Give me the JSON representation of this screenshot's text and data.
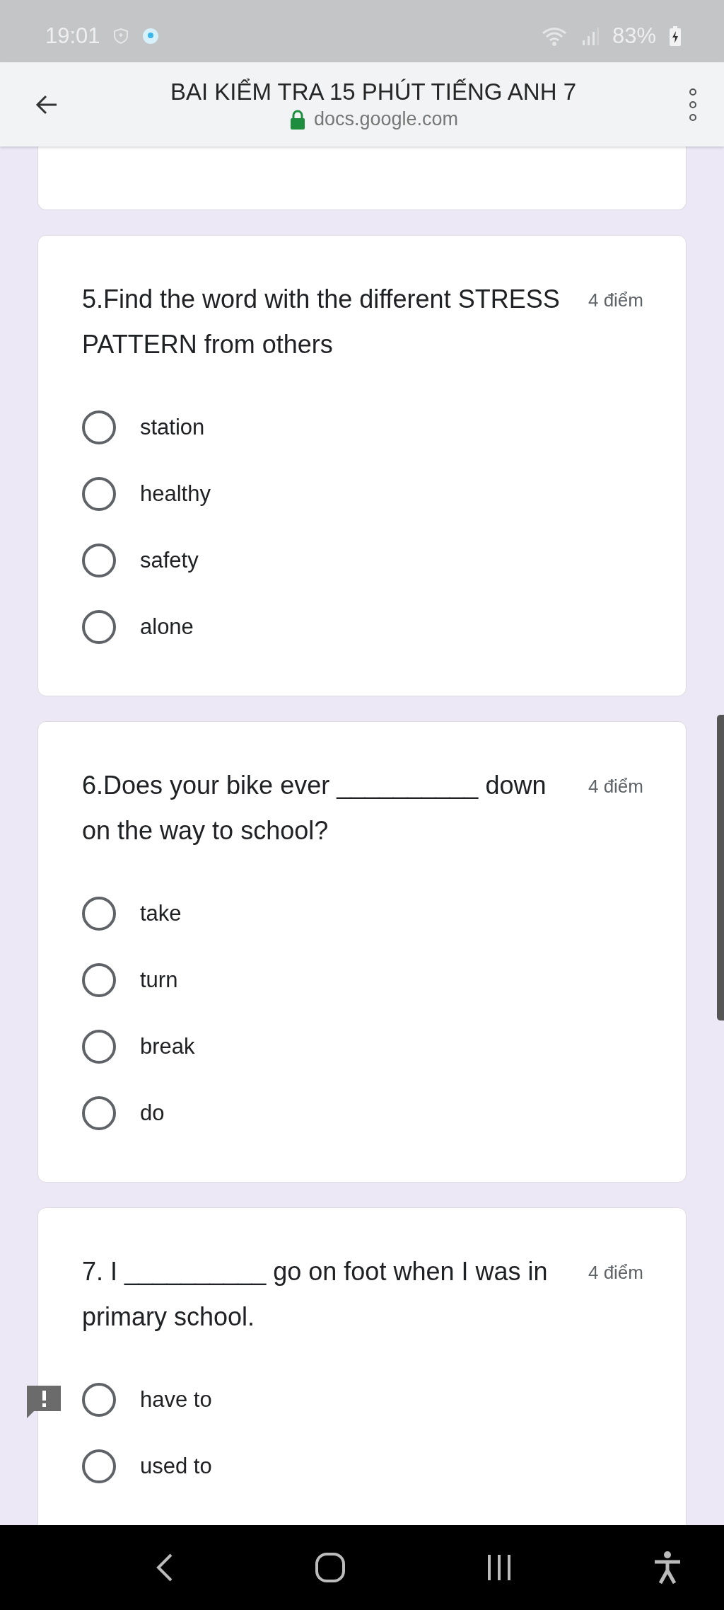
{
  "status_bar": {
    "time": "19:01",
    "battery": "83%"
  },
  "header": {
    "title": "BAI KIỂM TRA 15 PHÚT TIẾNG ANH 7",
    "url": "docs.google.com"
  },
  "questions": [
    {
      "text": "5.Find the word with the different STRESS PATTERN from others",
      "points": "4 điểm",
      "options": [
        {
          "label": "station",
          "selected": false
        },
        {
          "label": "healthy",
          "selected": false
        },
        {
          "label": "safety",
          "selected": false
        },
        {
          "label": "alone",
          "selected": false
        }
      ]
    },
    {
      "text": "6.Does your bike ever __________ down on the way to school?",
      "points": "4 điểm",
      "options": [
        {
          "label": "take",
          "selected": false
        },
        {
          "label": "turn",
          "selected": false
        },
        {
          "label": "break",
          "selected": false
        },
        {
          "label": "do",
          "selected": false
        }
      ]
    },
    {
      "text": "7. I __________ go on foot when I was in primary school.",
      "points": "4 điểm",
      "options": [
        {
          "label": "have to",
          "selected": false
        },
        {
          "label": "used to",
          "selected": false
        }
      ]
    }
  ]
}
